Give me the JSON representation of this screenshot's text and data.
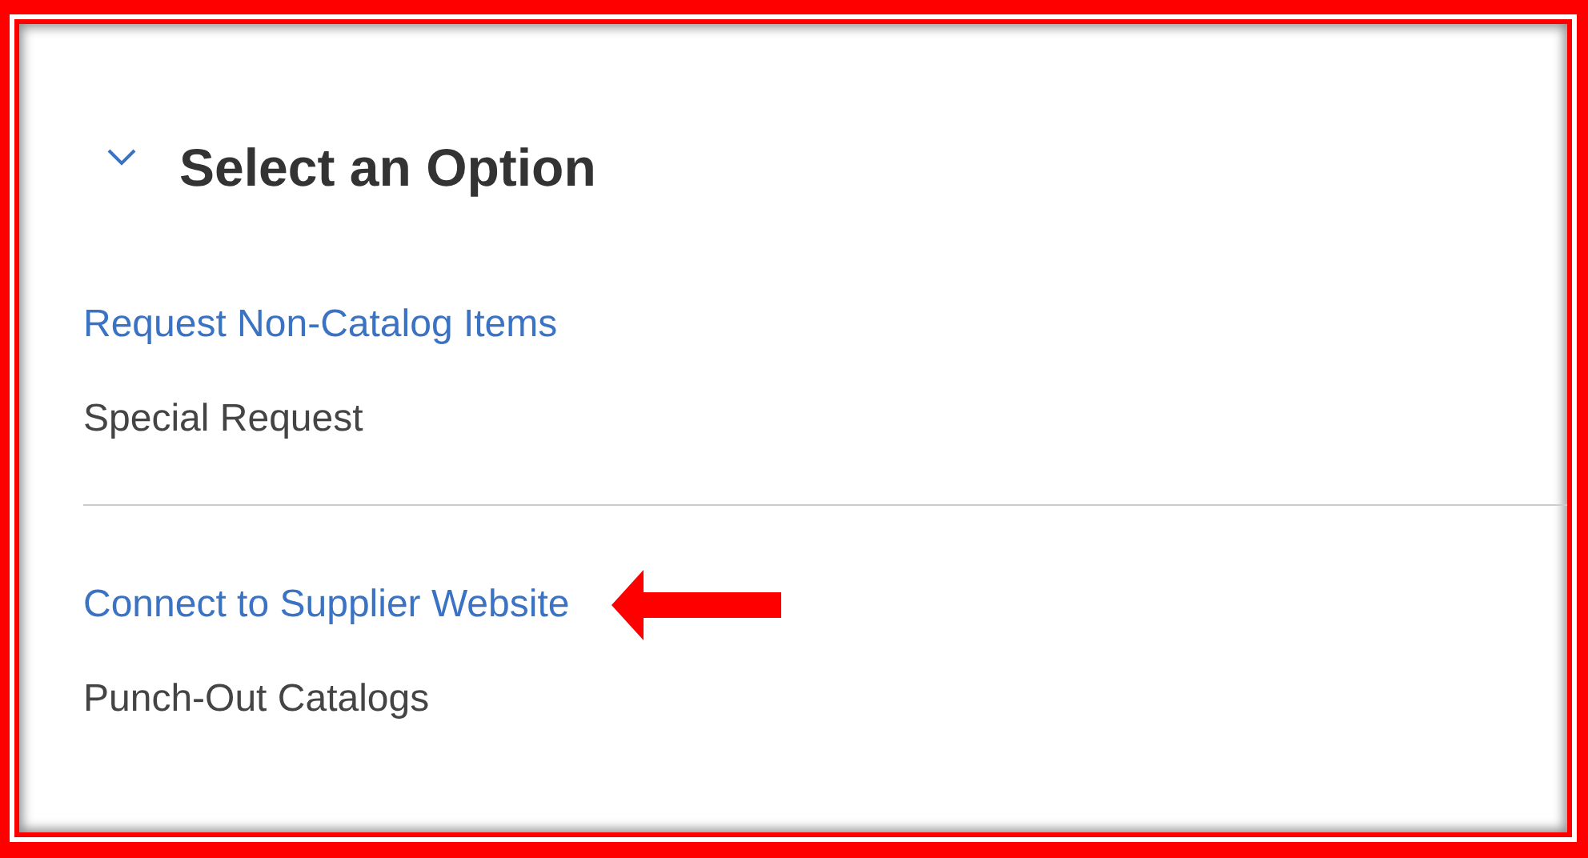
{
  "section": {
    "title": "Select an Option",
    "expanded": true
  },
  "groups": [
    {
      "link": "Request Non-Catalog Items",
      "description": "Special Request",
      "highlighted": false
    },
    {
      "link": "Connect to Supplier Website",
      "description": "Punch-Out Catalogs",
      "highlighted": true
    }
  ]
}
